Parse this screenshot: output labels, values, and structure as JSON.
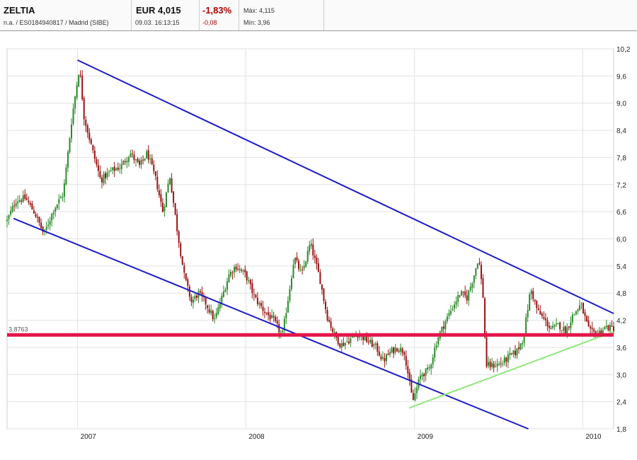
{
  "header": {
    "name": "ZELTIA",
    "sub": "n.a. / ES0184940817 / Madrid (SIBE)",
    "price": "EUR 4,015",
    "time": "09.03. 16:13:15",
    "change_pct": "-1,83%",
    "change_abs": "-0,08",
    "high": "Máx: 4,115",
    "low": "Mín: 3,96"
  },
  "chart_data": {
    "type": "line",
    "style": "candlestick",
    "title": "",
    "xlabel": "",
    "ylabel": "",
    "y_axis_position": "right",
    "ylim": [
      1.8,
      10.2
    ],
    "xlim": [
      "2006-08-01",
      "2010-03-09"
    ],
    "grid": true,
    "y_ticks": [
      "10,2",
      "9,6",
      "9,0",
      "8,4",
      "7,8",
      "7,2",
      "6,6",
      "6,0",
      "5,4",
      "4,8",
      "4,2",
      "3,6",
      "3,0",
      "2,4",
      "1,8"
    ],
    "x_ticks": [
      {
        "label": "2007",
        "date": "2007-01-01"
      },
      {
        "label": "2008",
        "date": "2008-01-01"
      },
      {
        "label": "2009",
        "date": "2009-01-01"
      },
      {
        "label": "2010",
        "date": "2010-01-01"
      }
    ],
    "up_color": "#2a8a2a",
    "down_color": "#9a1212",
    "series": [
      {
        "values": [
          [
            "2006-08-01",
            6.4
          ],
          [
            "2006-08-20",
            6.85
          ],
          [
            "2006-09-10",
            6.9
          ],
          [
            "2006-10-01",
            6.55
          ],
          [
            "2006-10-20",
            6.1
          ],
          [
            "2006-11-10",
            6.65
          ],
          [
            "2006-12-01",
            7.0
          ],
          [
            "2006-12-20",
            8.7
          ],
          [
            "2007-01-05",
            9.8
          ],
          [
            "2007-01-15",
            8.7
          ],
          [
            "2007-02-01",
            8.0
          ],
          [
            "2007-02-20",
            7.3
          ],
          [
            "2007-03-15",
            7.5
          ],
          [
            "2007-04-05",
            7.6
          ],
          [
            "2007-04-25",
            7.9
          ],
          [
            "2007-05-15",
            7.6
          ],
          [
            "2007-06-01",
            7.9
          ],
          [
            "2007-06-20",
            7.3
          ],
          [
            "2007-07-05",
            6.6
          ],
          [
            "2007-07-20",
            7.4
          ],
          [
            "2007-08-05",
            6.2
          ],
          [
            "2007-08-20",
            5.2
          ],
          [
            "2007-09-05",
            4.6
          ],
          [
            "2007-09-20",
            4.8
          ],
          [
            "2007-10-05",
            4.6
          ],
          [
            "2007-10-25",
            4.2
          ],
          [
            "2007-11-10",
            4.7
          ],
          [
            "2007-11-25",
            5.2
          ],
          [
            "2007-12-10",
            5.4
          ],
          [
            "2008-01-01",
            5.2
          ],
          [
            "2008-01-20",
            4.7
          ],
          [
            "2008-02-10",
            4.4
          ],
          [
            "2008-03-01",
            4.2
          ],
          [
            "2008-03-20",
            3.85
          ],
          [
            "2008-04-05",
            4.9
          ],
          [
            "2008-04-15",
            5.6
          ],
          [
            "2008-05-01",
            5.2
          ],
          [
            "2008-05-20",
            5.9
          ],
          [
            "2008-06-10",
            5.1
          ],
          [
            "2008-06-25",
            4.3
          ],
          [
            "2008-07-10",
            3.9
          ],
          [
            "2008-07-25",
            3.65
          ],
          [
            "2008-08-10",
            3.75
          ],
          [
            "2008-09-01",
            3.9
          ],
          [
            "2008-09-20",
            3.75
          ],
          [
            "2008-10-10",
            3.6
          ],
          [
            "2008-10-25",
            3.3
          ],
          [
            "2008-11-10",
            3.5
          ],
          [
            "2008-11-25",
            3.6
          ],
          [
            "2008-12-10",
            3.5
          ],
          [
            "2008-12-28",
            2.4
          ],
          [
            "2009-01-15",
            3.0
          ],
          [
            "2009-02-01",
            3.1
          ],
          [
            "2009-02-20",
            3.8
          ],
          [
            "2009-03-10",
            4.2
          ],
          [
            "2009-03-25",
            4.5
          ],
          [
            "2009-04-10",
            4.8
          ],
          [
            "2009-04-25",
            4.7
          ],
          [
            "2009-05-10",
            5.2
          ],
          [
            "2009-05-20",
            5.6
          ],
          [
            "2009-05-30",
            4.7
          ],
          [
            "2009-06-05",
            3.2
          ],
          [
            "2009-06-20",
            3.2
          ],
          [
            "2009-07-10",
            3.25
          ],
          [
            "2009-07-25",
            3.4
          ],
          [
            "2009-08-10",
            3.5
          ],
          [
            "2009-08-25",
            3.8
          ],
          [
            "2009-09-10",
            4.9
          ],
          [
            "2009-09-25",
            4.4
          ],
          [
            "2009-10-10",
            4.2
          ],
          [
            "2009-10-25",
            4.0
          ],
          [
            "2009-11-10",
            4.1
          ],
          [
            "2009-11-25",
            3.95
          ],
          [
            "2009-12-10",
            4.3
          ],
          [
            "2009-12-28",
            4.55
          ],
          [
            "2010-01-15",
            3.95
          ],
          [
            "2010-02-01",
            3.9
          ],
          [
            "2010-02-20",
            4.05
          ],
          [
            "2010-03-09",
            4.015
          ]
        ]
      }
    ],
    "annotations": [
      {
        "type": "trendline",
        "color": "#1c1cc8",
        "from": [
          "2007-01-01",
          9.95
        ],
        "to": [
          "2010-03-09",
          4.35
        ]
      },
      {
        "type": "trendline",
        "color": "#1c1cc8",
        "from": [
          "2006-08-15",
          6.45
        ],
        "to": [
          "2009-09-05",
          1.8
        ]
      },
      {
        "type": "trendline",
        "color": "#8ee87a",
        "from": [
          "2008-12-20",
          2.26
        ],
        "to": [
          "2010-03-09",
          3.95
        ]
      },
      {
        "type": "horizontal",
        "color": "#e4154a",
        "value": 3.8763,
        "label": "3,8763"
      }
    ]
  }
}
